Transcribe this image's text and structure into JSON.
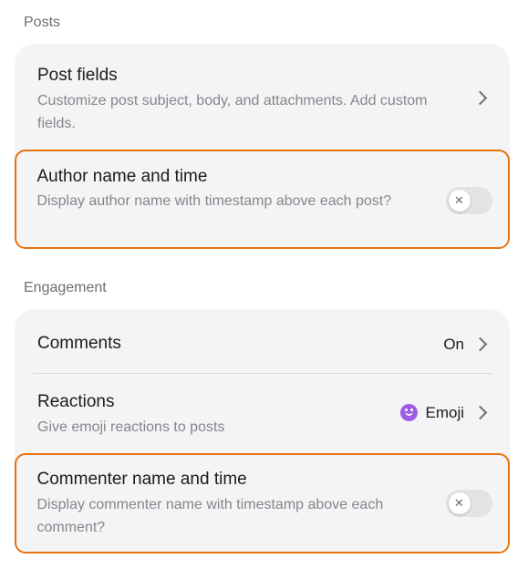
{
  "sections": {
    "posts": {
      "label": "Posts",
      "post_fields": {
        "title": "Post fields",
        "description": "Customize post subject, body, and attachments. Add custom fields."
      },
      "author_name_time": {
        "title": "Author name and time",
        "description": "Display author name with timestamp above each post?",
        "enabled": false
      }
    },
    "engagement": {
      "label": "Engagement",
      "comments": {
        "title": "Comments",
        "value": "On"
      },
      "reactions": {
        "title": "Reactions",
        "description": "Give emoji reactions to posts",
        "value": "Emoji",
        "icon": "smiley-face-icon"
      },
      "commenter_name_time": {
        "title": "Commenter name and time",
        "description": "Display commenter name with timestamp above each comment?",
        "enabled": false
      }
    }
  },
  "toggle_off_glyph": "✕",
  "colors": {
    "highlight": "#e8720c",
    "emoji_accent": "#9b5ce6",
    "card_background": "#f4f4f6"
  }
}
